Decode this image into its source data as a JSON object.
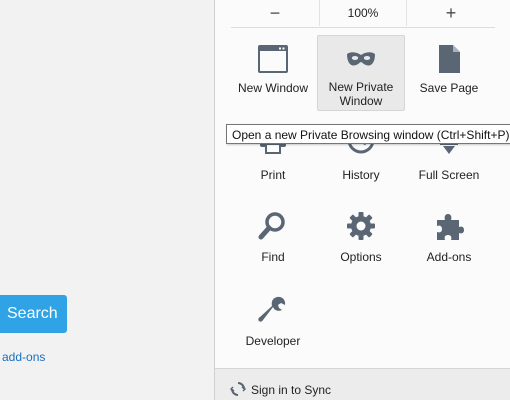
{
  "page": {
    "search_label": "Search",
    "addons_link": "add-ons"
  },
  "panel": {
    "zoom": {
      "minus": "−",
      "level": "100%",
      "plus": "+"
    },
    "items": [
      {
        "label": "New Window",
        "icon": "window-icon"
      },
      {
        "label": "New Private Window",
        "line1": "New Private",
        "line2": "Window",
        "icon": "private-mask-icon"
      },
      {
        "label": "Save Page",
        "icon": "save-page-icon"
      },
      {
        "label": "Print",
        "icon": "print-icon"
      },
      {
        "label": "History",
        "icon": "history-icon"
      },
      {
        "label": "Full Screen",
        "icon": "fullscreen-icon"
      },
      {
        "label": "Find",
        "icon": "search-icon"
      },
      {
        "label": "Options",
        "icon": "gear-icon"
      },
      {
        "label": "Add-ons",
        "icon": "puzzle-icon"
      },
      {
        "label": "Developer",
        "icon": "wrench-icon"
      }
    ],
    "footer": {
      "label": "Sign in to Sync",
      "icon": "sync-icon"
    }
  },
  "tooltip": {
    "text": "Open a new Private Browsing window (Ctrl+Shift+P)"
  },
  "colors": {
    "accent": "#2fa3e6",
    "link": "#1a6fc0",
    "icon": "#4c5a68"
  }
}
